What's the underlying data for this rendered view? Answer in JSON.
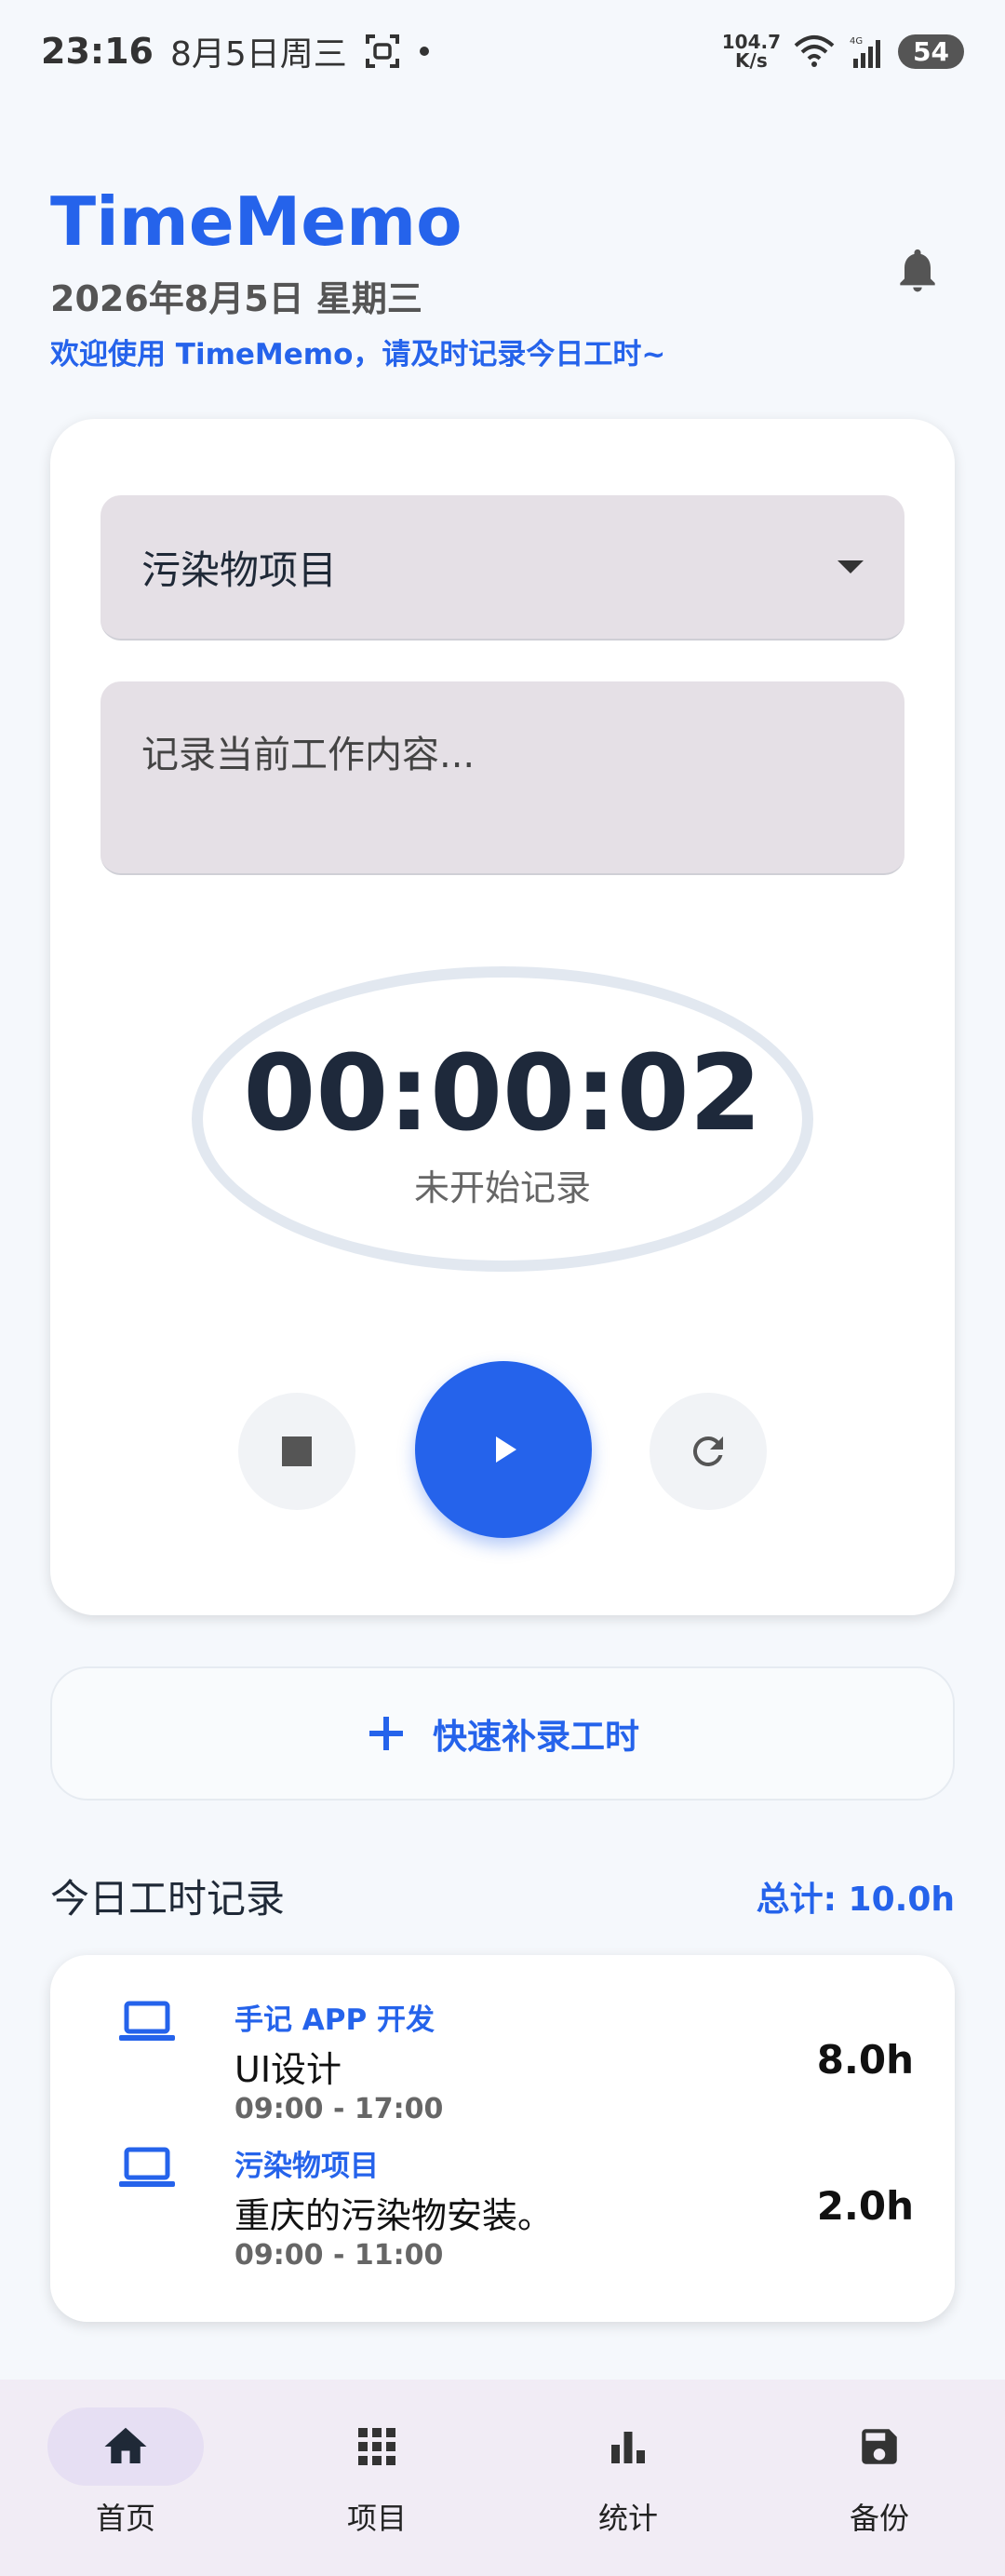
{
  "status_bar": {
    "time": "23:16",
    "date": "8月5日周三",
    "net_speed_value": "104.7",
    "net_speed_unit": "K/s",
    "network_type": "4G",
    "battery": "54"
  },
  "header": {
    "title": "TimeMemo",
    "date": "2026年8月5日 星期三",
    "welcome": "欢迎使用 TimeMemo，请及时记录今日工时~"
  },
  "timer_card": {
    "selected_project": "污染物项目",
    "work_placeholder": "记录当前工作内容...",
    "timer_value": "00:00:02",
    "timer_status": "未开始记录"
  },
  "quick_add": {
    "label": "快速补录工时"
  },
  "records": {
    "title": "今日工时记录",
    "total": "总计: 10.0h",
    "items": [
      {
        "project": "手记 APP 开发",
        "task": "UI设计",
        "time": "09:00 - 17:00",
        "hours": "8.0h"
      },
      {
        "project": "污染物项目",
        "task": "重庆的污染物安装。",
        "time": "09:00 - 11:00",
        "hours": "2.0h"
      }
    ]
  },
  "nav": {
    "items": [
      {
        "label": "首页",
        "icon": "home-icon"
      },
      {
        "label": "项目",
        "icon": "grid-icon"
      },
      {
        "label": "统计",
        "icon": "bar-chart-icon"
      },
      {
        "label": "备份",
        "icon": "save-icon"
      }
    ]
  },
  "colors": {
    "accent": "#2563eb",
    "card_bg": "#ffffff",
    "input_bg": "#e5e0e6"
  }
}
